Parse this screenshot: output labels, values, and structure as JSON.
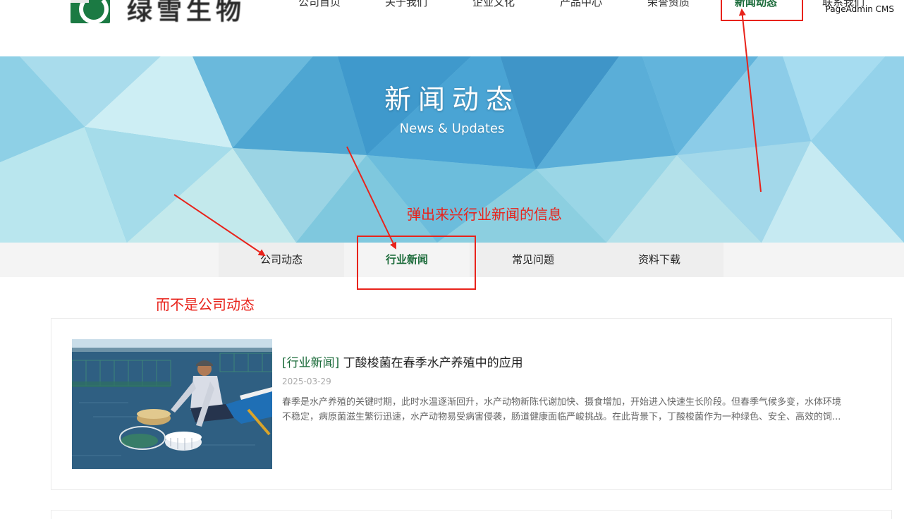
{
  "header": {
    "logo_text": "绿雪生物",
    "nav": [
      {
        "label": "公司首页"
      },
      {
        "label": "关于我们"
      },
      {
        "label": "企业文化"
      },
      {
        "label": "产品中心"
      },
      {
        "label": "荣誉资质"
      },
      {
        "label": "新闻动态",
        "active": true
      },
      {
        "label": "联系我们"
      }
    ],
    "cms_badge": "PageAdmin CMS"
  },
  "banner": {
    "title": "新闻动态",
    "subtitle": "News & Updates"
  },
  "subnav": {
    "tabs": [
      {
        "label": "公司动态"
      },
      {
        "label": "行业新闻",
        "active": true
      },
      {
        "label": "常见问题"
      },
      {
        "label": "资料下载"
      }
    ]
  },
  "news": [
    {
      "category": "[行业新闻]",
      "title": "丁酸梭菌在春季水产养殖中的应用",
      "date": "2025-03-29",
      "summary_line1": "春季是水产养殖的关键时期，此时水温逐渐回升，水产动物新陈代谢加快、摄食增加，开始进入快速生长阶段。但春季气候多变，水体环境",
      "summary_line2": "不稳定，病原菌滋生繁衍迅速，水产动物易受病害侵袭，肠道健康面临严峻挑战。在此背景下，丁酸梭菌作为一种绿色、安全、高效的饲..."
    }
  ],
  "annotations": {
    "note_top": "弹出来兴行业新闻的信息",
    "note_left": "而不是公司动态",
    "color": "#e8231b"
  },
  "colors": {
    "brand_green": "#1b6b3a",
    "banner_blue": "#5fb6dc"
  }
}
